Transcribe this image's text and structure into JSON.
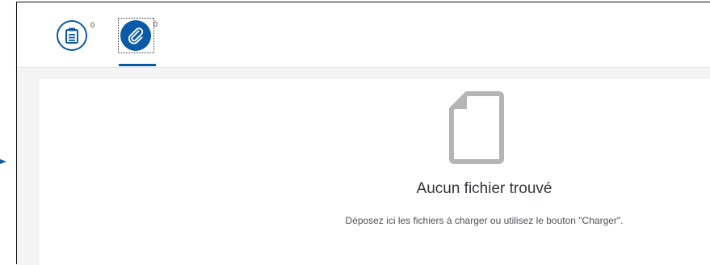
{
  "tabs": [
    {
      "id": "notes",
      "icon": "notes-icon",
      "count": "0"
    },
    {
      "id": "attachments",
      "icon": "paperclip-icon",
      "count": "0",
      "selected": true
    }
  ],
  "empty_state": {
    "icon": "empty-file-icon",
    "title": "Aucun fichier trouvé",
    "description": "Déposez ici les fichiers à charger ou utilisez le bouton \"Charger\"."
  },
  "colors": {
    "accent": "#0a5aa7",
    "background": "#f4f4f4",
    "icon_gray": "#b5b5b5"
  }
}
